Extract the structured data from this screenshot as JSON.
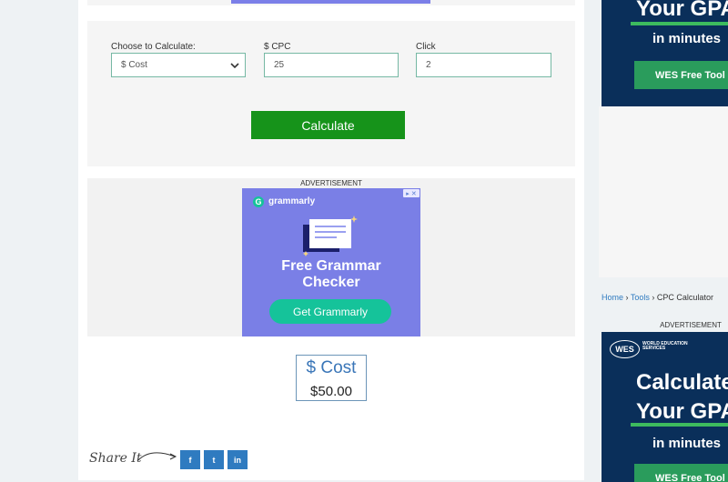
{
  "calculator": {
    "select_label": "Choose to Calculate:",
    "select_value": "$ Cost",
    "cpc_label": "$ CPC",
    "cpc_value": "25",
    "click_label": "Click",
    "click_value": "2",
    "calculate_button": "Calculate"
  },
  "advertisement_label": "ADVERTISEMENT",
  "grammarly_ad": {
    "badge_x": "✕",
    "logo_letter": "G",
    "brand": "grammarly",
    "headline_line1": "Free Grammar",
    "headline_line2": "Checker",
    "cta": "Get Grammarly"
  },
  "result": {
    "title": "$ Cost",
    "value": "$50.00"
  },
  "share": {
    "label": "Share It",
    "facebook": "f",
    "twitter": "t",
    "linkedin": "in"
  },
  "side_ad_top": {
    "line1": "Your GPA",
    "line2": "in minutes",
    "tool_button": "WES Free Tool"
  },
  "breadcrumb": {
    "home": "Home",
    "sep1": "›",
    "tools": "Tools",
    "sep2": "›",
    "current": "CPC Calculator"
  },
  "side_ad_bottom": {
    "logo": "WES",
    "org": "WORLD EDUCATION SERVICES",
    "line1": "Calculate",
    "line2": "Your GPA",
    "line3": "in minutes",
    "tool_button": "WES Free Tool"
  },
  "colors": {
    "calculate_green": "#16931a",
    "grammarly_purple": "#7a7fe6",
    "grammarly_teal": "#15c39a",
    "wes_navy": "#0a2f5a",
    "social_blue": "#2f7bc0"
  }
}
